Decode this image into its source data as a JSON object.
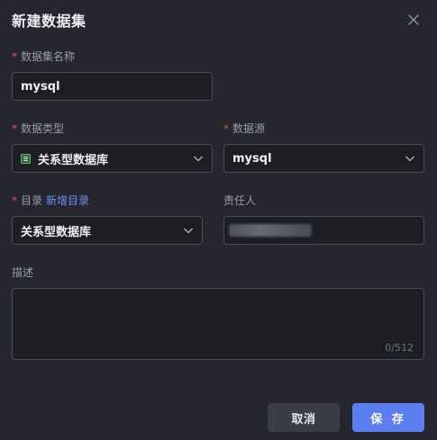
{
  "dialog": {
    "title": "新建数据集",
    "close_icon": "close-icon"
  },
  "dataset_name": {
    "required_mark": "*",
    "label": "数据集名称",
    "value": "mysql"
  },
  "data_type": {
    "required_mark": "*",
    "label": "数据类型",
    "value": "关系型数据库",
    "icon": "database-table-icon"
  },
  "data_source": {
    "required_mark": "*",
    "label": "数据源",
    "value": "mysql"
  },
  "catalog": {
    "required_mark": "*",
    "label": "目录",
    "add_link": "新增目录",
    "value": "关系型数据库"
  },
  "owner": {
    "label": "责任人"
  },
  "description": {
    "label": "描述",
    "value": "",
    "counter": "0/512"
  },
  "buttons": {
    "cancel": "取消",
    "save": "保 存"
  },
  "colors": {
    "background": "#26272e",
    "input_bg": "#1d1e24",
    "required": "#e0524f",
    "link": "#6b8cf5",
    "primary": "#5b7ff0"
  }
}
